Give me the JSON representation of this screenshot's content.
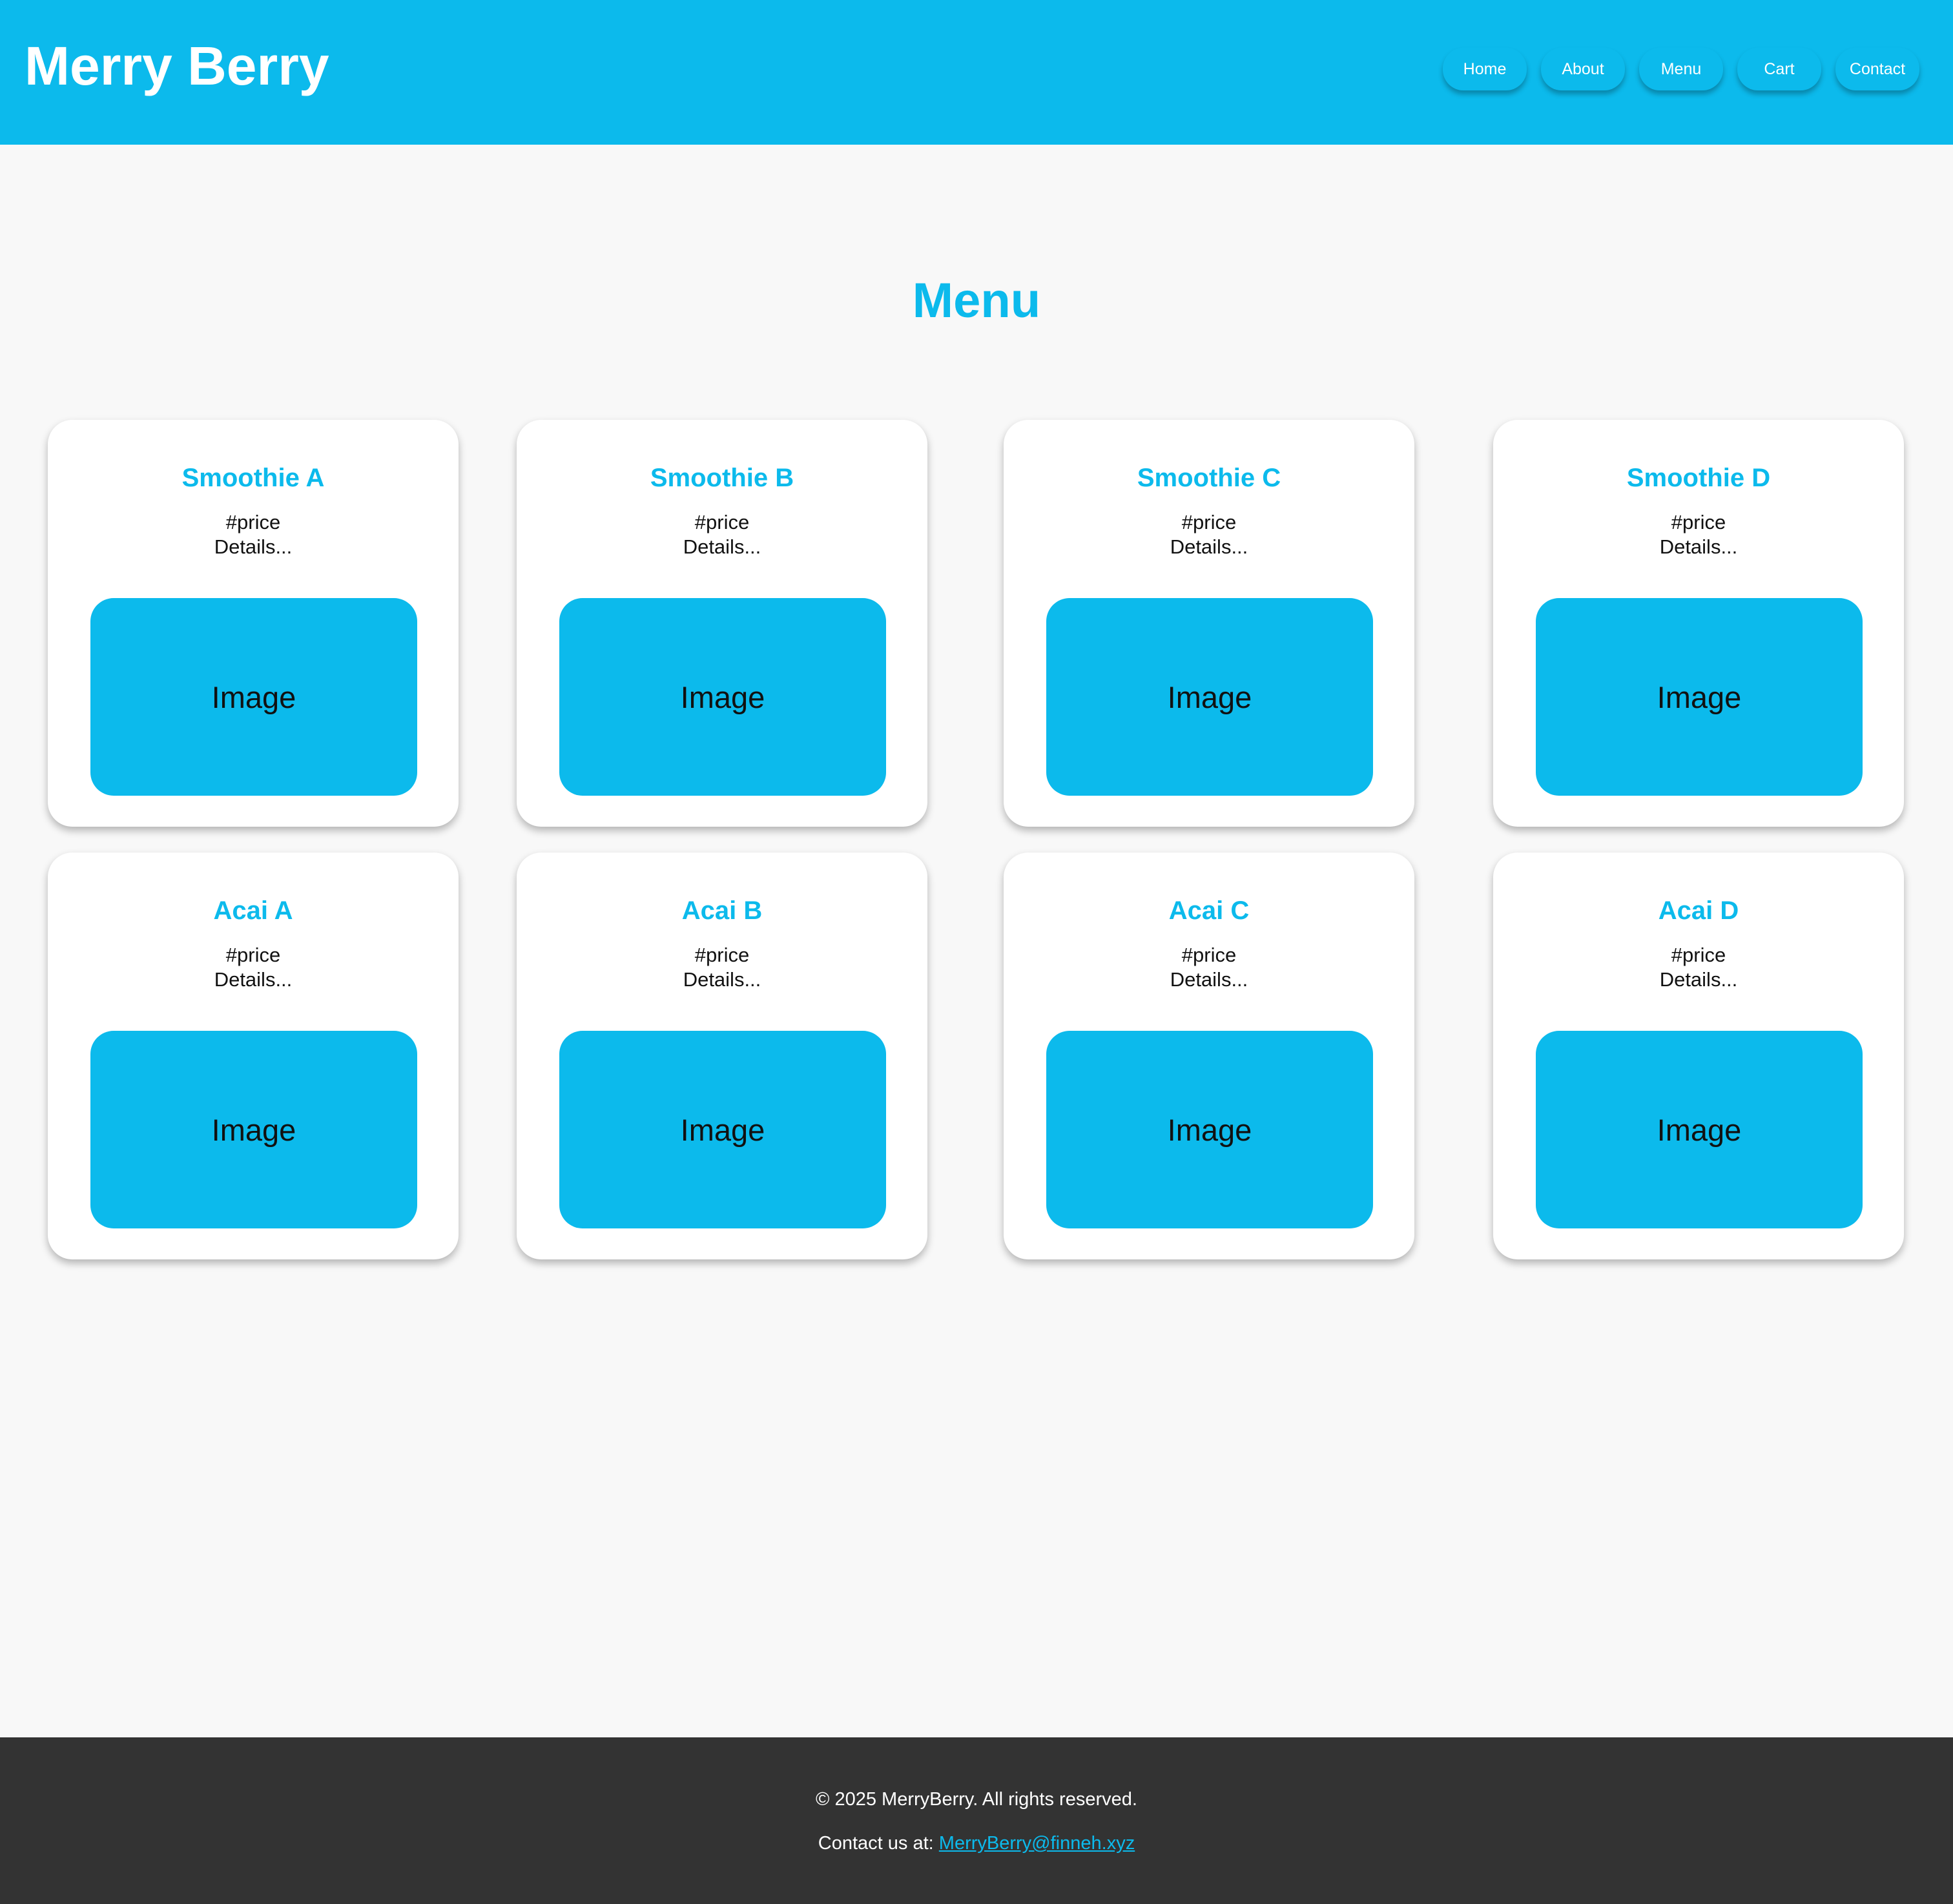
{
  "header": {
    "brand": "Merry Berry",
    "nav": [
      {
        "label": "Home"
      },
      {
        "label": "About"
      },
      {
        "label": "Menu"
      },
      {
        "label": "Cart"
      },
      {
        "label": "Contact"
      }
    ]
  },
  "main": {
    "title": "Menu",
    "items": [
      {
        "name": "Smoothie A",
        "price": "#price",
        "details": "Details...",
        "image_label": "Image"
      },
      {
        "name": "Smoothie B",
        "price": "#price",
        "details": "Details...",
        "image_label": "Image"
      },
      {
        "name": "Smoothie C",
        "price": "#price",
        "details": "Details...",
        "image_label": "Image"
      },
      {
        "name": "Smoothie D",
        "price": "#price",
        "details": "Details...",
        "image_label": "Image"
      },
      {
        "name": "Acai A",
        "price": "#price",
        "details": "Details...",
        "image_label": "Image"
      },
      {
        "name": "Acai B",
        "price": "#price",
        "details": "Details...",
        "image_label": "Image"
      },
      {
        "name": "Acai C",
        "price": "#price",
        "details": "Details...",
        "image_label": "Image"
      },
      {
        "name": "Acai D",
        "price": "#price",
        "details": "Details...",
        "image_label": "Image"
      }
    ]
  },
  "footer": {
    "copyright": "© 2025 MerryBerry. All rights reserved.",
    "contact_prefix": "Contact us at: ",
    "email": "MerryBerry@finneh.xyz"
  },
  "colors": {
    "accent": "#0cbaec",
    "background": "#f8f8f8",
    "footer": "#333333",
    "card": "#ffffff"
  }
}
